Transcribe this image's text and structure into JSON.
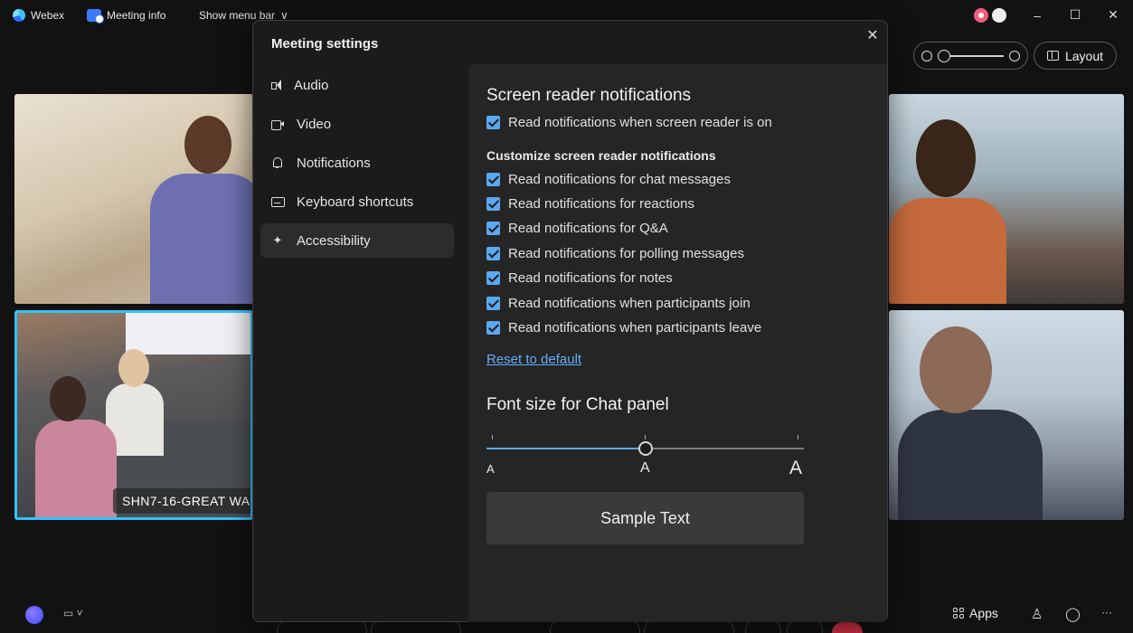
{
  "titlebar": {
    "app_name": "Webex",
    "meeting_info": "Meeting info",
    "show_menu_bar": "Show menu bar",
    "minimize": "–",
    "maximize": "☐",
    "close": "✕"
  },
  "tiles": {
    "room_name": "SHN7-16-GREAT WA"
  },
  "controls": {
    "layout_label": "Layout"
  },
  "bottombar": {
    "apps_label": "Apps"
  },
  "modal": {
    "title": "Meeting settings",
    "close": "✕",
    "nav": [
      {
        "label": "Audio",
        "icon": "speaker-icon"
      },
      {
        "label": "Video",
        "icon": "camera-icon"
      },
      {
        "label": "Notifications",
        "icon": "bell-icon"
      },
      {
        "label": "Keyboard shortcuts",
        "icon": "keyboard-icon"
      },
      {
        "label": "Accessibility",
        "icon": "accessibility-icon",
        "active": true
      }
    ]
  },
  "accessibility": {
    "section_title": "Screen reader notifications",
    "master_toggle": {
      "label": "Read notifications when screen reader is on",
      "checked": true
    },
    "customize_title": "Customize screen reader notifications",
    "options": [
      {
        "label": "Read notifications for chat messages",
        "checked": true
      },
      {
        "label": "Read notifications for reactions",
        "checked": true
      },
      {
        "label": "Read notifications for Q&A",
        "checked": true
      },
      {
        "label": "Read notifications for polling messages",
        "checked": true
      },
      {
        "label": "Read notifications for notes",
        "checked": true
      },
      {
        "label": "Read notifications when participants join",
        "checked": true
      },
      {
        "label": "Read notifications when participants leave",
        "checked": true
      }
    ],
    "reset_label": "Reset to default",
    "font_size_title": "Font size for Chat panel",
    "font_slider": {
      "small_label": "A",
      "medium_label": "A",
      "large_label": "A",
      "value_fraction": 0.5
    },
    "sample_text": "Sample Text"
  },
  "colors": {
    "accent": "#5aa8f0",
    "tile_highlight": "#2fc3ff",
    "panel_bg": "#252526",
    "modal_bg": "#1b1b1c"
  }
}
